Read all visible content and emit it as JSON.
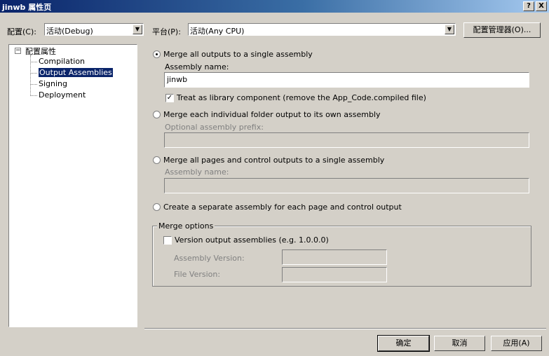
{
  "window": {
    "title": "jinwb 属性页",
    "help_label": "?",
    "close_label": "X"
  },
  "toolbar": {
    "config_label": "配置(C):",
    "config_value": "活动(Debug)",
    "platform_label": "平台(P):",
    "platform_value": "活动(Any CPU)",
    "config_manager_label": "配置管理器(O)..."
  },
  "tree": {
    "root": {
      "expander": "−",
      "label": "配置属性"
    },
    "items": [
      {
        "label": "Compilation",
        "selected": false
      },
      {
        "label": "Output Assemblies",
        "selected": true
      },
      {
        "label": "Signing",
        "selected": false
      },
      {
        "label": "Deployment",
        "selected": false
      }
    ]
  },
  "options": {
    "merge_all": {
      "label": "Merge all outputs to a single assembly",
      "selected": true,
      "name_label": "Assembly name:",
      "name_value": "jinwb",
      "treat_library_label": "Treat as library component (remove the App_Code.compiled file)",
      "treat_library_checked": true,
      "check_mark": "✓"
    },
    "merge_each": {
      "label": "Merge each individual folder output to its own assembly",
      "selected": false,
      "prefix_label": "Optional assembly prefix:",
      "prefix_value": ""
    },
    "merge_pages": {
      "label": "Merge all pages and control outputs to a single assembly",
      "selected": false,
      "name_label": "Assembly name:",
      "name_value": ""
    },
    "separate": {
      "label": "Create a separate assembly for each page and control output",
      "selected": false
    }
  },
  "merge_options": {
    "legend": "Merge options",
    "version_label": "Version output assemblies (e.g. 1.0.0.0)",
    "version_checked": false,
    "assembly_version_label": "Assembly Version:",
    "assembly_version_value": "",
    "file_version_label": "File Version:",
    "file_version_value": ""
  },
  "footer": {
    "ok_label": "确定",
    "cancel_label": "取消",
    "apply_label": "应用(A)"
  },
  "icons": {
    "dropdown_arrow": "▼"
  }
}
